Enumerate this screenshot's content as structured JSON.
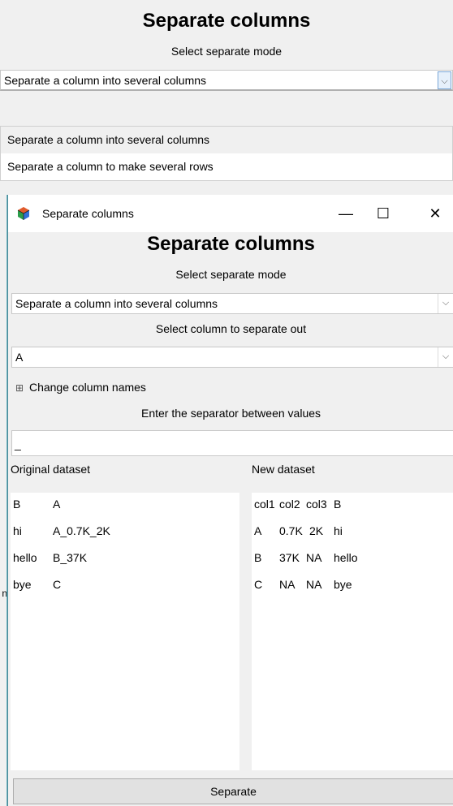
{
  "background_screen": {
    "title": "Separate columns",
    "mode_label": "Select separate mode",
    "mode_value": "Separate a column into several columns",
    "dropdown_options": [
      "Separate a column into several columns",
      "Separate a column to make several rows"
    ],
    "behind_char": "n"
  },
  "window": {
    "titlebar_title": "Separate columns",
    "minimize_glyph": "—",
    "maximize_glyph": "☐",
    "close_glyph": "✕",
    "title": "Separate columns",
    "mode_label": "Select separate mode",
    "mode_value": "Separate a column into several columns",
    "column_label": "Select column to separate out",
    "column_value": "A",
    "change_names_toggle": "⊞",
    "change_names_label": "Change column names",
    "separator_label": "Enter the separator between values",
    "separator_value": "_",
    "original_title": "Original dataset",
    "original_headers": [
      "B",
      "A"
    ],
    "original_rows": [
      [
        "hi",
        "A_0.7K_2K"
      ],
      [
        "hello",
        "B_37K"
      ],
      [
        "bye",
        "C"
      ]
    ],
    "new_title": "New dataset",
    "new_headers": [
      "col1",
      "col2",
      "col3",
      "B"
    ],
    "new_rows": [
      [
        "A",
        "0.7K",
        "2K",
        "hi"
      ],
      [
        "B",
        "37K",
        "NA",
        "hello"
      ],
      [
        "C",
        "NA",
        "NA",
        "bye"
      ]
    ],
    "separate_button": "Separate"
  },
  "icons": {
    "app_icon": "cube-icon",
    "chevron": "chevron-down-icon"
  }
}
